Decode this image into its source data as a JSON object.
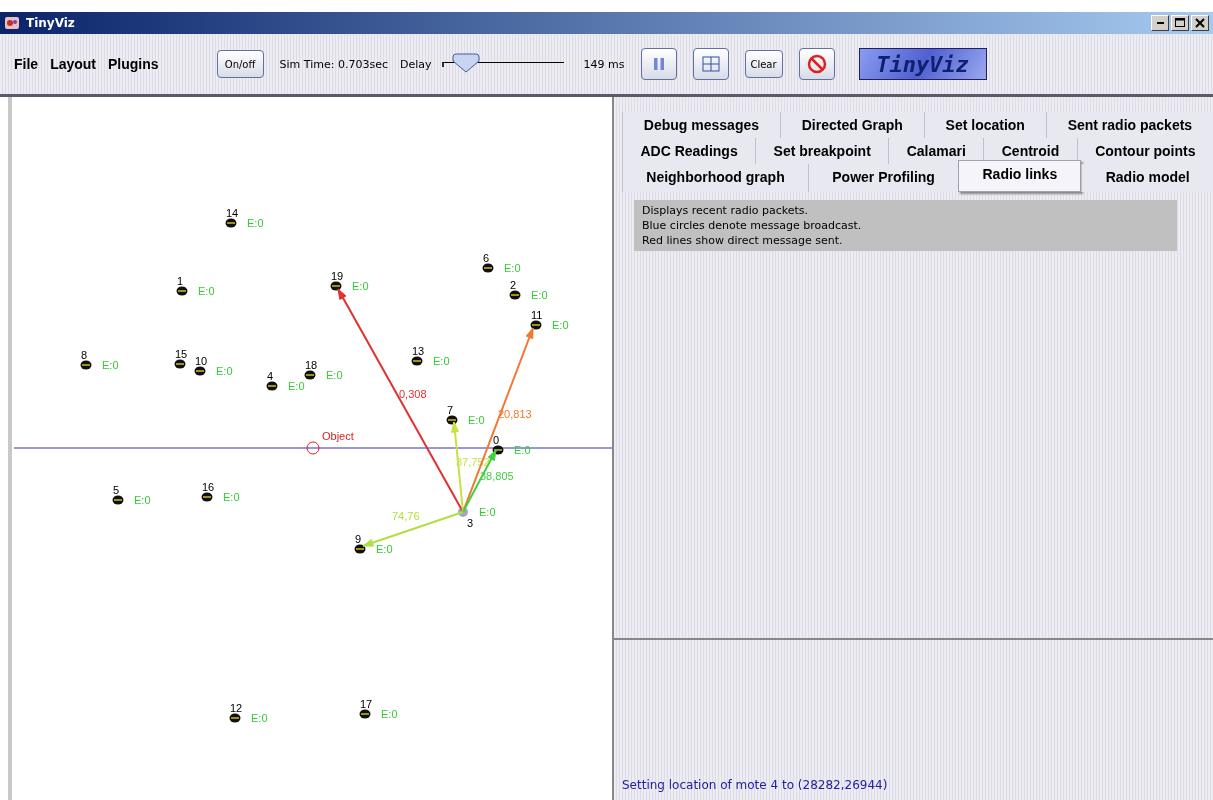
{
  "window": {
    "title": "TinyViz"
  },
  "menu": [
    "File",
    "Layout",
    "Plugins"
  ],
  "toolbar": {
    "power_button": "On/off",
    "sim_time": "Sim Time:  0.703sec",
    "delay_label": "Delay",
    "delay_slider": {
      "level": 0.2
    },
    "delay_reading": "149 ms",
    "clear_button": "Clear",
    "logo": "TinyViz"
  },
  "canvas": {
    "motes": [
      {
        "id": "14",
        "energy": "E:0",
        "kind": "mote"
      },
      {
        "id": "1",
        "energy": "E:0",
        "kind": "mote"
      },
      {
        "id": "8",
        "energy": "E:0",
        "kind": "mote"
      },
      {
        "id": "15",
        "kind": "mote"
      },
      {
        "id": "10",
        "energy": "E:0",
        "kind": "mote"
      },
      {
        "id": "4",
        "energy": "E:0",
        "kind": "mote"
      },
      {
        "id": "18",
        "energy": "E:0",
        "kind": "mote"
      },
      {
        "id": "19",
        "energy": "E:0",
        "kind": "mote"
      },
      {
        "id": "6",
        "energy": "E:0",
        "kind": "mote"
      },
      {
        "id": "2",
        "energy": "E:0",
        "kind": "mote"
      },
      {
        "id": "11",
        "energy": "E:0",
        "kind": "mote"
      },
      {
        "id": "13",
        "energy": "E:0",
        "kind": "mote"
      },
      {
        "id": "7",
        "energy": "E:0",
        "kind": "mote"
      },
      {
        "id": "0",
        "energy": "E:0",
        "kind": "mote"
      },
      {
        "id": "3",
        "energy": "E:0",
        "kind": "sender"
      },
      {
        "id": "9",
        "energy": "E:0",
        "kind": "mote"
      },
      {
        "id": "5",
        "energy": "E:0",
        "kind": "mote"
      },
      {
        "id": "16",
        "energy": "E:0",
        "kind": "mote"
      },
      {
        "id": "12",
        "energy": "E:0",
        "kind": "mote"
      },
      {
        "id": "17",
        "energy": "E:0",
        "kind": "mote"
      }
    ],
    "links": [
      {
        "label": "0,308",
        "color": "#e03030"
      },
      {
        "label": "20,813",
        "color": "#f07830"
      },
      {
        "label": "37,752",
        "color": "#c8e040"
      },
      {
        "label": "38,805",
        "color": "#40d040"
      },
      {
        "label": "74,76",
        "color": "#b0e040"
      }
    ],
    "object": {
      "label": "Object"
    }
  },
  "tabs": [
    [
      {
        "label": "Debug messages",
        "selected": false
      },
      {
        "label": "Directed Graph",
        "selected": false
      },
      {
        "label": "Set location",
        "selected": false
      },
      {
        "label": "Sent radio packets",
        "selected": false
      }
    ],
    [
      {
        "label": "ADC Readings",
        "selected": false
      },
      {
        "label": "Set breakpoint",
        "selected": false
      },
      {
        "label": "Calamari",
        "selected": false
      },
      {
        "label": "Centroid",
        "selected": false
      },
      {
        "label": "Contour points",
        "selected": false
      }
    ],
    [
      {
        "label": "Neighborhood graph",
        "selected": false
      },
      {
        "label": "Power Profiling",
        "selected": false
      },
      {
        "label": "Radio links",
        "selected": true
      },
      {
        "label": "Radio model",
        "selected": false
      }
    ]
  ],
  "description": [
    "Displays recent radio packets.",
    "Blue circles denote message broadcast.",
    "Red lines show direct message sent."
  ],
  "status_bar": "Setting location of mote 4 to (28282,26944)"
}
